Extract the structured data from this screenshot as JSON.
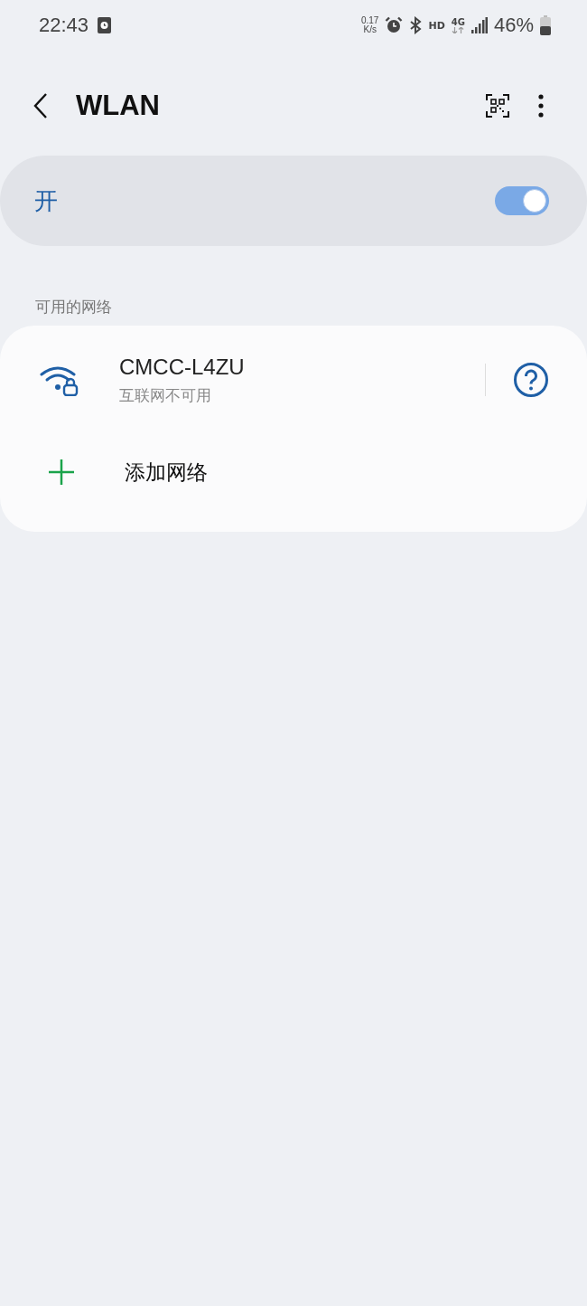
{
  "status_bar": {
    "time": "22:43",
    "speed_value": "0.17",
    "speed_unit": "K/s",
    "hd": "HD",
    "network": "4G",
    "battery": "46%"
  },
  "header": {
    "title": "WLAN"
  },
  "master_switch": {
    "label": "开",
    "on": true
  },
  "section_title": "可用的网络",
  "networks": [
    {
      "name": "CMCC-L4ZU",
      "status": "互联网不可用",
      "locked": true
    }
  ],
  "add_network": {
    "label": "添加网络"
  }
}
